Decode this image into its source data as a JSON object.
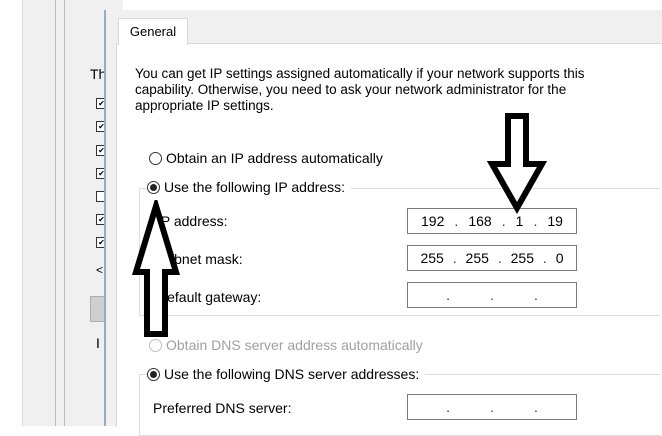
{
  "background": {
    "partial_label": "Th",
    "checkbox_marks": [
      "✔",
      "✔",
      "✔",
      "✔",
      "",
      "✔",
      "✔"
    ],
    "scroll_arrow": "<",
    "partial_label_2": "I"
  },
  "tab": {
    "general_label": "General"
  },
  "intro_text": "You can get IP settings assigned automatically if your network supports this capability. Otherwise, you need to ask your network administrator for the appropriate IP settings.",
  "ip_section": {
    "auto_label": "Obtain an IP address automatically",
    "manual_label": "Use the following IP address:",
    "selected": "manual",
    "fields": {
      "ip_label": "IP address:",
      "ip_octets": [
        "192",
        "168",
        "1",
        "19"
      ],
      "mask_label": "Subnet mask:",
      "mask_octets": [
        "255",
        "255",
        "255",
        "0"
      ],
      "gateway_label": "Default gateway:",
      "gateway_octets": [
        "",
        "",
        "",
        ""
      ]
    }
  },
  "dns_section": {
    "auto_label": "Obtain DNS server address automatically",
    "manual_label": "Use the following DNS server addresses:",
    "selected": "manual",
    "preferred_label": "Preferred DNS server:",
    "preferred_octets": [
      "",
      "",
      "",
      ""
    ]
  },
  "annotations": {
    "arrow_down": "hollow-down-arrow",
    "arrow_up": "hollow-up-arrow",
    "color": "#000000"
  }
}
